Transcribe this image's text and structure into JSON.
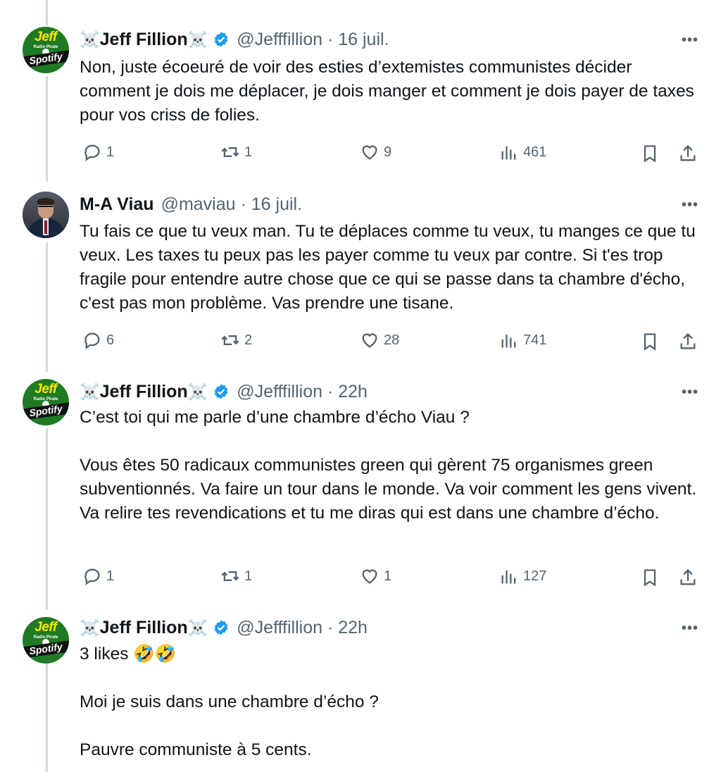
{
  "tweets": [
    {
      "name": "Jeff Fillion",
      "emoji_left": "☠️",
      "emoji_right": "☠️",
      "verified": true,
      "meta": "@Jefffillion · 16 juil.",
      "text": "Non, juste écoeuré de voir des esties d’extemistes communistes décider comment je dois me déplacer, je dois manger et comment je dois payer de taxes pour vos criss de folies.",
      "replies": "1",
      "retweets": "1",
      "likes": "9",
      "views": "461",
      "avatar": {
        "top": "Jeff",
        "mid": "Radio Pirate",
        "bottom": "Spotify"
      }
    },
    {
      "name": "M-A Viau",
      "emoji_left": "",
      "emoji_right": "",
      "verified": false,
      "meta": "@maviau · 16 juil.",
      "text": "Tu fais ce que tu veux man. Tu te déplaces comme tu veux, tu manges ce que tu veux. Les taxes tu peux pas les payer comme tu veux par contre. Si t'es trop fragile pour entendre autre chose que ce qui se passe dans ta chambre d'écho, c'est pas mon problème. Vas prendre une tisane.",
      "replies": "6",
      "retweets": "2",
      "likes": "28",
      "views": "741"
    },
    {
      "name": "Jeff Fillion",
      "emoji_left": "☠️",
      "emoji_right": "☠️",
      "verified": true,
      "meta": "@Jefffillion · 22h",
      "text": "C’est toi qui me parle d’une chambre d’écho Viau ?\n\nVous êtes 50 radicaux communistes green qui gèrent 75 organismes green subventionnés. Va faire un tour dans le monde. Va voir comment les gens vivent. Va relire tes revendications et tu me diras qui est dans une chambre d’écho.",
      "replies": "1",
      "retweets": "1",
      "likes": "1",
      "views": "127",
      "avatar": {
        "top": "Jeff",
        "mid": "Radio Pirate",
        "bottom": "Spotify"
      }
    },
    {
      "name": "Jeff Fillion",
      "emoji_left": "☠️",
      "emoji_right": "☠️",
      "verified": true,
      "meta": "@Jefffillion · 22h",
      "text": "3 likes 🤣🤣\n\nMoi je suis dans une chambre d’écho ?\n\nPauvre communiste à 5 cents.",
      "avatar": {
        "top": "Jeff",
        "mid": "Radio Pirate",
        "bottom": "Spotify"
      }
    }
  ],
  "more_label": "•••",
  "colors": {
    "verified": "#1d9bf0",
    "muted": "#536471",
    "thread_line": "#cfd9de",
    "text": "#0f1419"
  },
  "icons": [
    "reply-icon",
    "retweet-icon",
    "like-icon",
    "views-icon",
    "bookmark-icon",
    "share-icon",
    "verified-icon",
    "more-icon"
  ]
}
